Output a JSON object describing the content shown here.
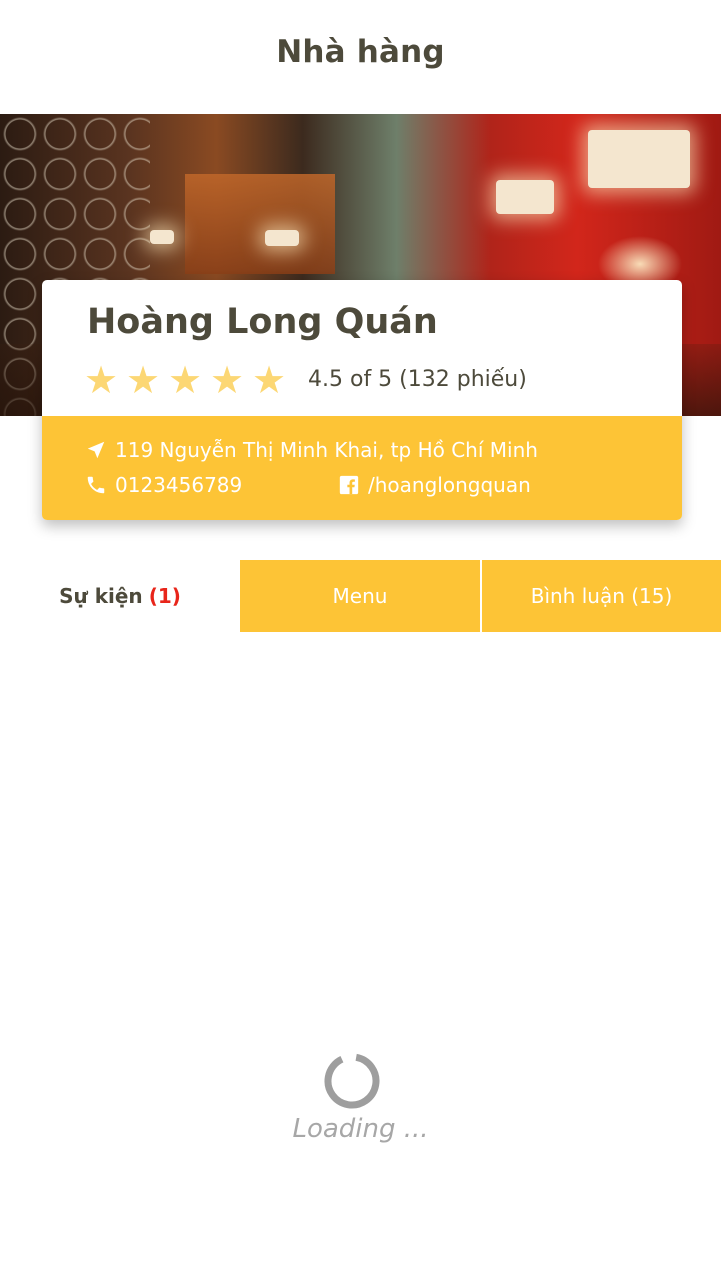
{
  "header": {
    "title": "Nhà hàng"
  },
  "restaurant": {
    "name": "Hoàng Long Quán",
    "rating": 4.5,
    "rating_max": 5,
    "rating_text": "4.5 of 5 (132 phiếu)",
    "address": "119 Nguyễn Thị Minh Khai, tp Hồ Chí Minh",
    "phone": "0123456789",
    "facebook": "/hoanglongquan"
  },
  "tabs": {
    "events_label": "Sự kiện",
    "events_count": "(1)",
    "menu_label": "Menu",
    "comments_label": "Bình luận (15)"
  },
  "status": {
    "loading": "Loading ..."
  },
  "colors": {
    "accent": "#fdc436",
    "star": "#fcd774",
    "text_dark": "#4d4a3b",
    "count_red": "#e8251a",
    "loading_gray": "#a7a7a7"
  },
  "icons": {
    "star": "star-icon",
    "address": "location-arrow-icon",
    "phone": "phone-icon",
    "facebook": "facebook-icon",
    "loader": "spinner-icon"
  }
}
